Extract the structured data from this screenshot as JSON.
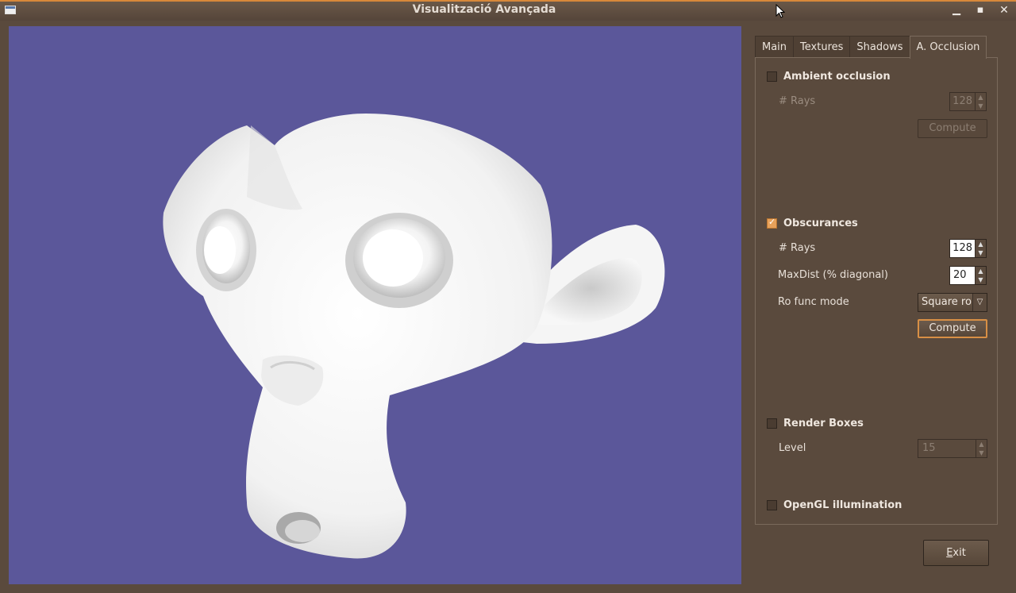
{
  "window": {
    "title": "Visualització Avançada"
  },
  "tabs": [
    {
      "label": "Main"
    },
    {
      "label": "Textures"
    },
    {
      "label": "Shadows"
    },
    {
      "label": "A. Occlusion"
    }
  ],
  "ambient_occlusion": {
    "checkbox_label": "Ambient occlusion",
    "checked": false,
    "rays_label": "# Rays",
    "rays_value": "128",
    "compute_label": "Compute"
  },
  "obscurances": {
    "checkbox_label": "Obscurances",
    "checked": true,
    "rays_label": "# Rays",
    "rays_value": "128",
    "maxdist_label": "MaxDist (% diagonal)",
    "maxdist_value": "20",
    "ro_label": "Ro func mode",
    "ro_value": "Square ro",
    "compute_label": "Compute"
  },
  "render_boxes": {
    "checkbox_label": "Render Boxes",
    "checked": false,
    "level_label": "Level",
    "level_value": "15"
  },
  "opengl": {
    "checkbox_label": "OpenGL illumination",
    "checked": false
  },
  "exit_label": "xit",
  "exit_mnemonic": "E",
  "colors": {
    "viewport_bg": "#5b579a",
    "accent": "#d8883a",
    "window_bg": "#5a4a3d"
  }
}
